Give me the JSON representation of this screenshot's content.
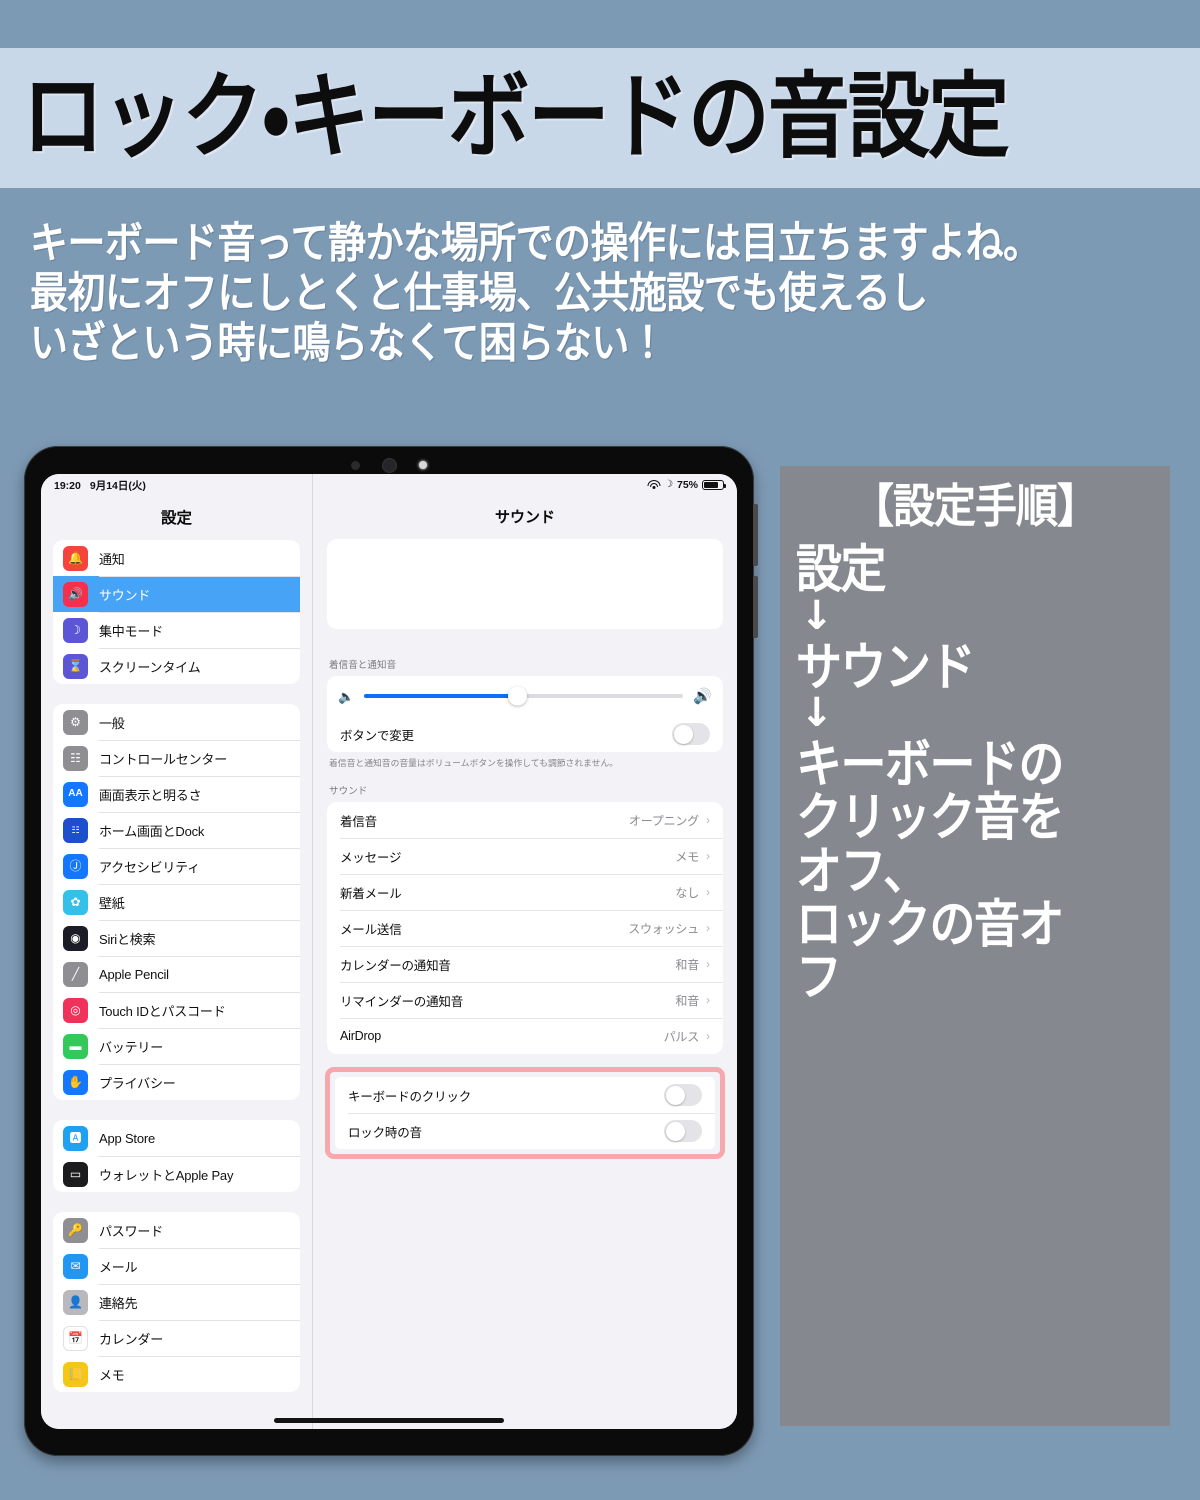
{
  "header": {
    "title": "ロック・キーボードの音設定",
    "subtitle_lines": [
      "キーボード音って静かな場所での操作には目立ちますよね。",
      "最初にオフにしとくと仕事場、公共施設でも使えるし",
      "いざという時に鳴らなくて困らない！"
    ]
  },
  "colors": {
    "page_background": "#7d9ab5",
    "title_band": "#c9d8e9",
    "steps_panel": "#85888e",
    "selected_row": "#46a3f5",
    "slider_fill": "#0b6efc",
    "highlight_border": "#f7a8ad"
  },
  "device": {
    "statusbar": {
      "time": "19:20",
      "date": "9月14日(火)",
      "wifi_icon": "wifi-icon",
      "dnd_icon": "moon-icon",
      "battery_percent": "75%",
      "battery_icon": "battery-icon"
    },
    "sidebar": {
      "title": "設定",
      "groups": [
        {
          "items": [
            {
              "label": "通知",
              "icon": "bell-icon",
              "icon_bg": "#f4453c",
              "selected": false
            },
            {
              "label": "サウンド",
              "icon": "speaker-icon",
              "icon_bg": "#f4304a",
              "selected": true
            },
            {
              "label": "集中モード",
              "icon": "moon-icon",
              "icon_bg": "#5c56d6",
              "selected": false
            },
            {
              "label": "スクリーンタイム",
              "icon": "hourglass-icon",
              "icon_bg": "#5c56d6",
              "selected": false
            }
          ]
        },
        {
          "items": [
            {
              "label": "一般",
              "icon": "gear-icon",
              "icon_bg": "#8e8e93",
              "selected": false
            },
            {
              "label": "コントロールセンター",
              "icon": "sliders-icon",
              "icon_bg": "#8e8e93",
              "selected": false
            },
            {
              "label": "画面表示と明るさ",
              "icon": "aa-icon",
              "icon_bg": "#1477ff",
              "selected": false
            },
            {
              "label": "ホーム画面とDock",
              "icon": "grid-icon",
              "icon_bg": "#1b4fcc",
              "selected": false
            },
            {
              "label": "アクセシビリティ",
              "icon": "accessibility-icon",
              "icon_bg": "#1477ff",
              "selected": false
            },
            {
              "label": "壁紙",
              "icon": "flower-icon",
              "icon_bg": "#34c0e8",
              "selected": false
            },
            {
              "label": "Siriと検索",
              "icon": "siri-icon",
              "icon_bg": "#1c1c26",
              "selected": false
            },
            {
              "label": "Apple Pencil",
              "icon": "pencil-icon",
              "icon_bg": "#8e8e93",
              "selected": false
            },
            {
              "label": "Touch IDとパスコード",
              "icon": "fingerprint-icon",
              "icon_bg": "#f0325a",
              "selected": false
            },
            {
              "label": "バッテリー",
              "icon": "battery-icon",
              "icon_bg": "#34c759",
              "selected": false
            },
            {
              "label": "プライバシー",
              "icon": "hand-icon",
              "icon_bg": "#1477ff",
              "selected": false
            }
          ]
        },
        {
          "items": [
            {
              "label": "App Store",
              "icon": "appstore-icon",
              "icon_bg": "#1da1f2",
              "selected": false
            },
            {
              "label": "ウォレットとApple Pay",
              "icon": "wallet-icon",
              "icon_bg": "#1c1c1e",
              "selected": false
            }
          ]
        },
        {
          "items": [
            {
              "label": "パスワード",
              "icon": "key-icon",
              "icon_bg": "#8e8e93",
              "selected": false
            },
            {
              "label": "メール",
              "icon": "mail-icon",
              "icon_bg": "#2196f3",
              "selected": false
            },
            {
              "label": "連絡先",
              "icon": "contacts-icon",
              "icon_bg": "#b8b8bd",
              "selected": false
            },
            {
              "label": "カレンダー",
              "icon": "calendar-icon",
              "icon_bg": "#ffffff",
              "selected": false
            },
            {
              "label": "メモ",
              "icon": "notes-icon",
              "icon_bg": "#f5c518",
              "selected": false
            }
          ]
        }
      ]
    },
    "detail": {
      "title": "サウンド",
      "volume_section": {
        "header": "着信音と通知音",
        "slider_percent": 48,
        "speaker_low_icon": "speaker-low-icon",
        "speaker_high_icon": "speaker-high-icon",
        "change_with_buttons_label": "ボタンで変更",
        "change_with_buttons_on": false,
        "footer": "着信音と通知音の音量はボリュームボタンを操作しても調節されません。"
      },
      "sounds_section": {
        "header": "サウンド",
        "rows": [
          {
            "label": "着信音",
            "value": "オープニング"
          },
          {
            "label": "メッセージ",
            "value": "メモ"
          },
          {
            "label": "新着メール",
            "value": "なし"
          },
          {
            "label": "メール送信",
            "value": "スウォッシュ"
          },
          {
            "label": "カレンダーの通知音",
            "value": "和音"
          },
          {
            "label": "リマインダーの通知音",
            "value": "和音"
          },
          {
            "label": "AirDrop",
            "value": "パルス"
          }
        ]
      },
      "highlighted_toggles": [
        {
          "label": "キーボードのクリック",
          "on": false
        },
        {
          "label": "ロック時の音",
          "on": false
        }
      ]
    }
  },
  "steps_panel": {
    "title": "【設定手順】",
    "lines": [
      {
        "type": "text",
        "text": "設定"
      },
      {
        "type": "arrow",
        "text": "↓"
      },
      {
        "type": "text",
        "text": "サウンド"
      },
      {
        "type": "arrow",
        "text": "↓"
      },
      {
        "type": "text",
        "text": "キーボードの"
      },
      {
        "type": "text",
        "text": "クリック音を"
      },
      {
        "type": "text",
        "text": "オフ、"
      },
      {
        "type": "text",
        "text": "ロックの音オ"
      },
      {
        "type": "text",
        "text": "フ"
      }
    ]
  }
}
